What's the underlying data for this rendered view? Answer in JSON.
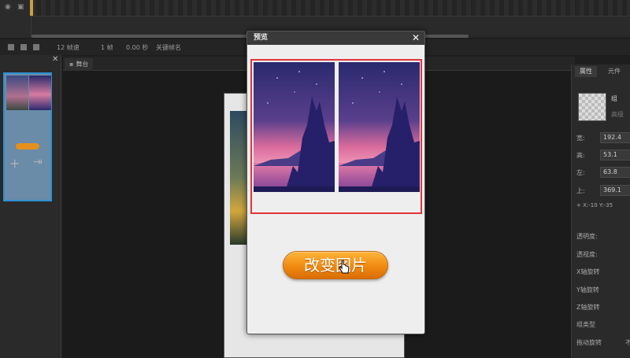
{
  "statusbar": {
    "fps": "12 帧速",
    "frame": "1 帧",
    "time": "0.00 秒",
    "keyframe_label": "关键帧名"
  },
  "left_panel": {
    "add_icon": "plus-icon",
    "import_icon": "import-page-icon"
  },
  "stage": {
    "tab_label": "舞台"
  },
  "right_panel": {
    "tabs": [
      "属性",
      "元件"
    ],
    "group_label": "组",
    "advanced_label": "高级",
    "width_label": "宽:",
    "width_value": "192.4",
    "height_label": "高:",
    "height_value": "53.1",
    "left_label": "左:",
    "left_value": "63.8",
    "top_label": "上:",
    "top_value": "369.1",
    "xy_readout": "+ X:-10  Y:-35",
    "props": [
      "透明度:",
      "透视度:",
      "X轴旋转",
      "Y轴旋转",
      "Z轴旋转",
      "组类型",
      "拖动旋转",
      "不"
    ]
  },
  "dialog": {
    "title": "预览",
    "close_icon": "close-icon",
    "button_label": "改变图片"
  },
  "colors": {
    "accent_red": "#e0343c",
    "button_orange": "#f08a10",
    "selection_blue": "#2f8fd0"
  }
}
